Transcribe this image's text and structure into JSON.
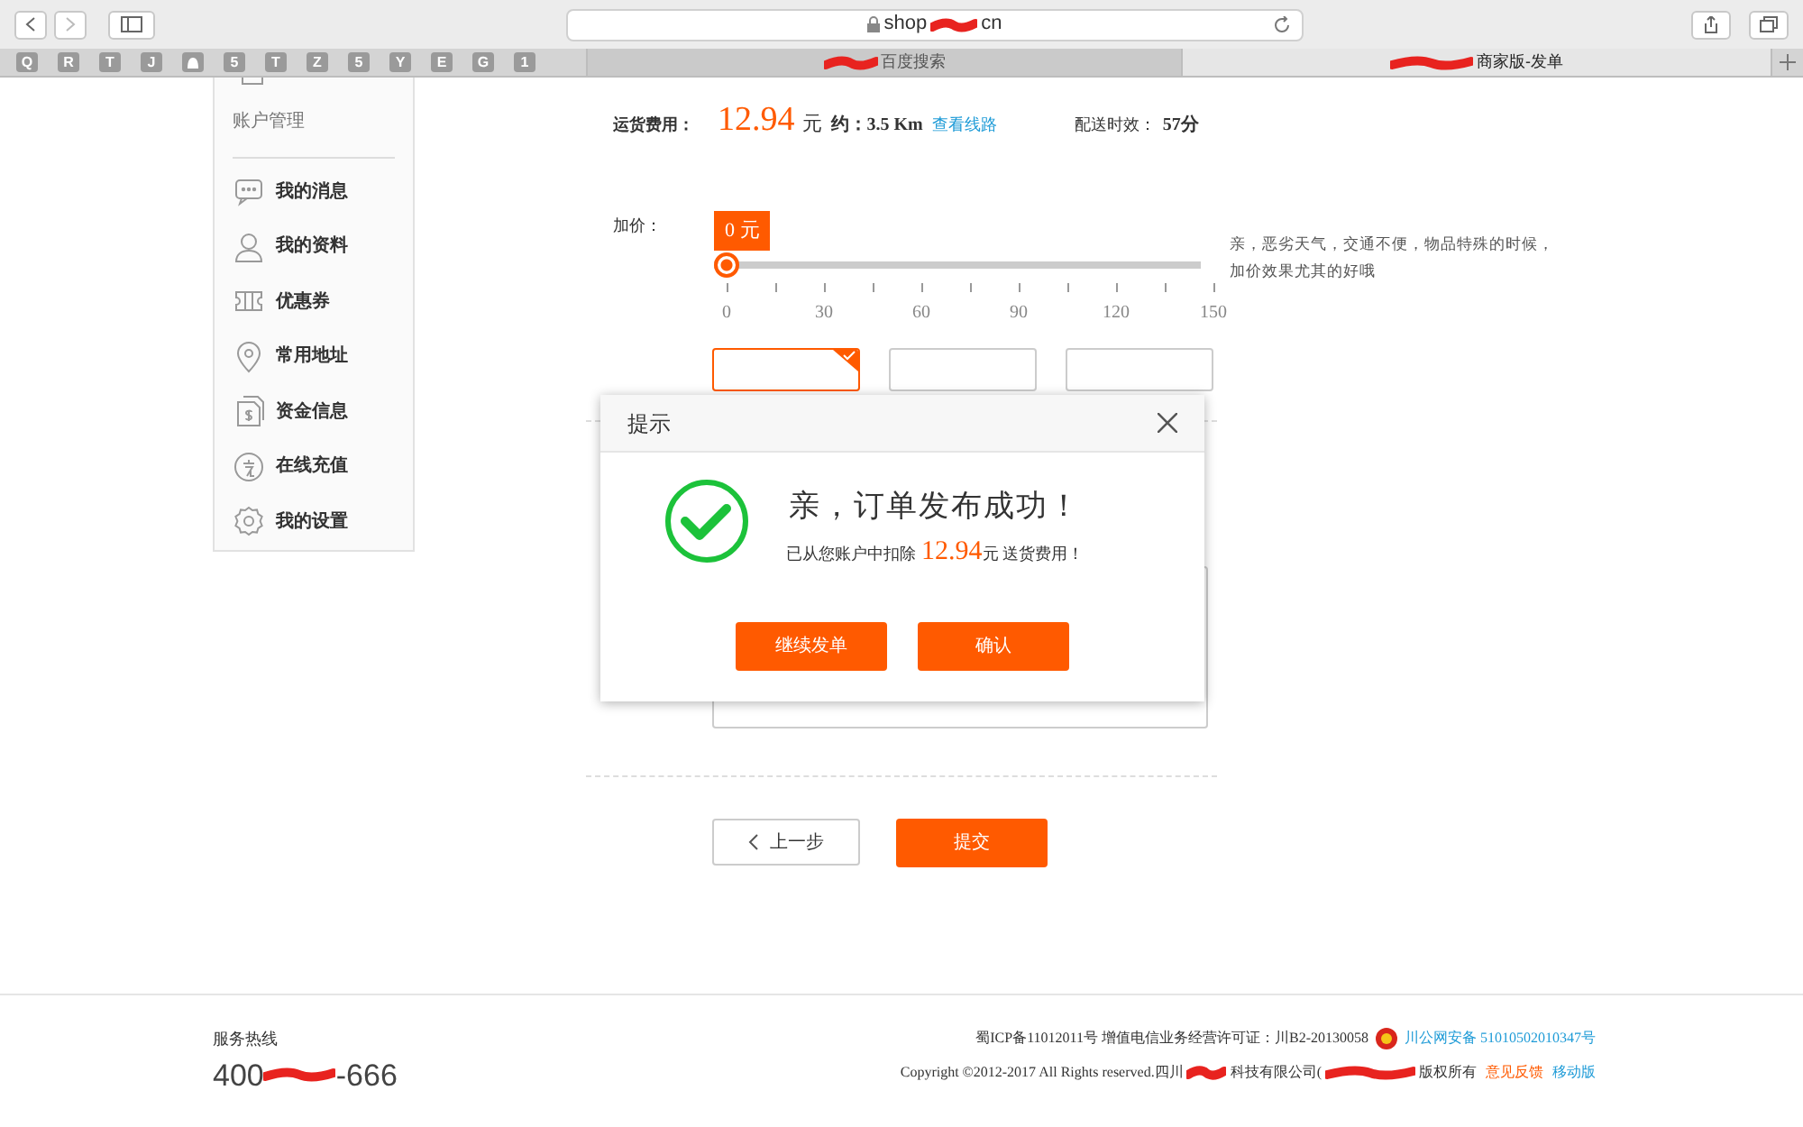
{
  "browser": {
    "url_start": "shop",
    "url_end": "cn",
    "bookmarks": [
      {
        "kind": "letter",
        "label": "Q"
      },
      {
        "kind": "letter",
        "label": "R"
      },
      {
        "kind": "letter",
        "label": "T"
      },
      {
        "kind": "letter",
        "label": "J"
      },
      {
        "kind": "icon"
      },
      {
        "kind": "letter",
        "label": "5"
      },
      {
        "kind": "letter",
        "label": "T"
      },
      {
        "kind": "letter",
        "label": "Z"
      },
      {
        "kind": "letter",
        "label": "5"
      },
      {
        "kind": "letter",
        "label": "Y"
      },
      {
        "kind": "letter",
        "label": "E"
      },
      {
        "kind": "letter",
        "label": "G"
      },
      {
        "kind": "letter",
        "label": "1"
      }
    ],
    "tabs": [
      {
        "label": "百度搜索",
        "selected": false
      },
      {
        "label": "商家版-发单",
        "selected": true
      }
    ]
  },
  "sidebar": {
    "section": "账户管理",
    "items": [
      {
        "label": "我的消息",
        "kind": "message"
      },
      {
        "label": "我的资料",
        "kind": "user"
      },
      {
        "label": "优惠券",
        "kind": "ticket"
      },
      {
        "label": "常用地址",
        "kind": "pin"
      },
      {
        "label": "资金信息",
        "kind": "money"
      },
      {
        "label": "在线充值",
        "kind": "recharge"
      },
      {
        "label": "我的设置",
        "kind": "settings"
      }
    ]
  },
  "fee": {
    "label": "运货费用：",
    "amount": "12.94",
    "unit": "元",
    "distance": "约：3.5 Km",
    "route_link": "查看线路",
    "time_label": "配送时效：",
    "time": "57分"
  },
  "markup": {
    "label": "加价：",
    "value": "0 元",
    "level": 0,
    "ticks": [
      "0",
      "30",
      "60",
      "90",
      "120",
      "150"
    ],
    "hint": "亲，恶劣天气，交通不便，物品特殊的时候，加价效果尤其的好哦"
  },
  "payment_options": [
    {
      "selected": true
    },
    {
      "selected": false
    },
    {
      "selected": false
    }
  ],
  "buttons": {
    "back": "上一步",
    "submit": "提交"
  },
  "dialog": {
    "title": "提示",
    "heading": "亲，订单发布成功！",
    "message_start": "已从您账户中扣除",
    "amount": "12.94",
    "message_end": "元 送货费用！",
    "buttons": [
      "继续发单",
      "确认"
    ]
  },
  "footer": {
    "hotline_label": "服务热线",
    "hotline_start": "400",
    "hotline_end": "-666",
    "icp": "蜀ICP备11012011号 增值电信业务经营许可证：川B2-20130058",
    "police": "川公网安备 51010502010347号",
    "copyright_start": "Copyright ©2012-2017 All Rights reserved.四川",
    "copyright_mid": "科技有限公司(",
    "copyright_end": "版权所有",
    "feedback": "意见反馈",
    "mobile": "移动版"
  }
}
